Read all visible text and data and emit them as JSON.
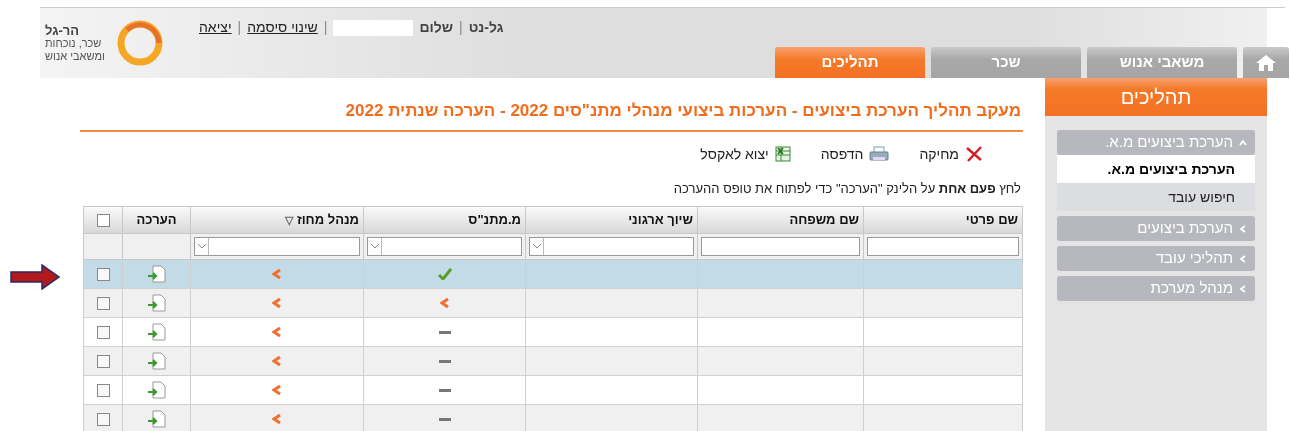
{
  "header": {
    "logo": {
      "name": "הר-גל",
      "tagline_1": "שכר, נוכחות",
      "tagline_2": "ומשאבי אנוש"
    },
    "greeting": [
      {
        "kind": "site",
        "text": "גל-נט"
      },
      {
        "kind": "separator",
        "text": "|"
      },
      {
        "kind": "hello",
        "text": "שלום"
      },
      {
        "kind": "redacted"
      },
      {
        "kind": "separator",
        "text": "|"
      },
      {
        "kind": "link",
        "text": "שינוי סיסמה"
      },
      {
        "kind": "separator",
        "text": "|"
      },
      {
        "kind": "link",
        "text": "יציאה"
      }
    ],
    "tabs": [
      {
        "kind": "home",
        "selected": false
      },
      {
        "kind": "text",
        "label": "משאבי אנוש",
        "selected": false
      },
      {
        "kind": "text",
        "label": "שכר",
        "selected": false
      },
      {
        "kind": "text",
        "label": "תהליכים",
        "selected": true
      }
    ]
  },
  "sidebar": {
    "title": "תהליכים",
    "groups": [
      {
        "label": "הערכת ביצועים מ.א.",
        "expanded": true,
        "children": [
          {
            "label": "הערכת ביצועים מ.א.",
            "selected": true
          },
          {
            "label": "חיפוש עובד",
            "selected": false
          }
        ]
      },
      {
        "label": "הערכת ביצועים",
        "expanded": false
      },
      {
        "label": "תהליכי עובד",
        "expanded": false
      },
      {
        "label": "מנהל מערכת",
        "expanded": false
      }
    ]
  },
  "main": {
    "title": "מעקב תהליך הערכת ביצועים - הערכות ביצועי מנהלי מתנ\"סים 2022 - הערכה שנתית 2022",
    "toolbar": [
      {
        "kind": "delete",
        "label": "מחיקה"
      },
      {
        "kind": "print",
        "label": "הדפסה"
      },
      {
        "kind": "excel",
        "label": "יצוא לאקסל"
      }
    ],
    "instruction": "לחץ **פעם אחת** על הלינק \"הערכה\" כדי לפתוח את טופס ההערכה",
    "table": {
      "select_all_checked": false,
      "columns": [
        {
          "label": "שם פרטי",
          "filter": {
            "kind": "text"
          }
        },
        {
          "label": "שם משפחה",
          "filter": {
            "kind": "text"
          }
        },
        {
          "label": "שיוך ארגוני",
          "filter": {
            "kind": "select"
          }
        },
        {
          "label": "מ.מתנ\"ס",
          "filter": {
            "kind": "select"
          }
        },
        {
          "label": "מנהל מחוז",
          "sort_mark": "▽",
          "filter": {
            "kind": "select"
          }
        },
        {
          "label": "הערכה"
        }
      ],
      "rows": [
        {
          "selected": true,
          "checked": false,
          "center_manager": {
            "kind": "approved"
          },
          "district_manager": {
            "kind": "pending"
          }
        },
        {
          "selected": false,
          "checked": false,
          "center_manager": {
            "kind": "pending"
          },
          "district_manager": {
            "kind": "pending"
          }
        },
        {
          "selected": false,
          "checked": false,
          "center_manager": {
            "kind": "none"
          },
          "district_manager": {
            "kind": "pending"
          }
        },
        {
          "selected": false,
          "checked": false,
          "center_manager": {
            "kind": "none"
          },
          "district_manager": {
            "kind": "pending"
          }
        },
        {
          "selected": false,
          "checked": false,
          "center_manager": {
            "kind": "none"
          },
          "district_manager": {
            "kind": "pending"
          }
        },
        {
          "selected": false,
          "checked": false,
          "center_manager": {
            "kind": "none"
          },
          "district_manager": {
            "kind": "pending"
          }
        }
      ]
    }
  },
  "annotation": {
    "kind": "arrow"
  }
}
